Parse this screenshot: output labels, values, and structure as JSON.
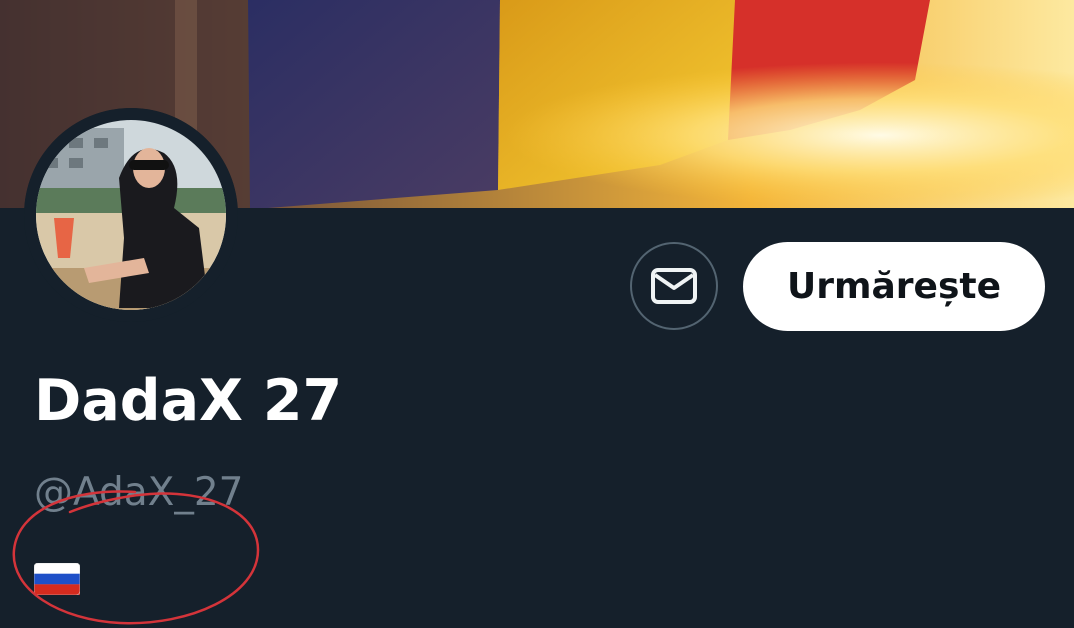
{
  "profile": {
    "display_name": "DadaX 27",
    "handle": "@AdaX_27",
    "bio_flag": "russia-flag-emoji"
  },
  "actions": {
    "message_icon": "envelope-icon",
    "follow_label": "Urmărește"
  },
  "colors": {
    "background": "#15202b",
    "follow_button_bg": "#ffffff",
    "handle_text": "#71808d",
    "annotation": "#d4343a"
  }
}
